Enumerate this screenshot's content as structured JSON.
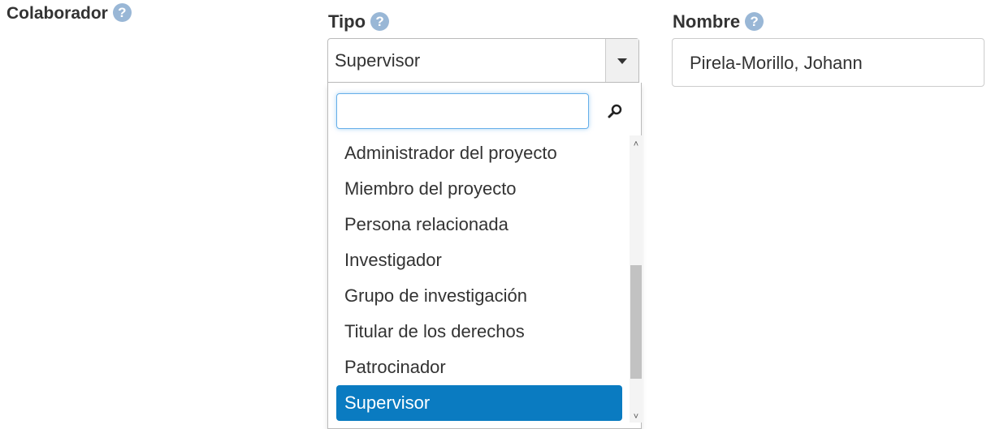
{
  "form": {
    "section_label": "Colaborador",
    "help_glyph": "?",
    "tipo": {
      "label": "Tipo",
      "selected_value": "Supervisor"
    },
    "nombre": {
      "label": "Nombre",
      "value": "Pirela-Morillo, Johann"
    }
  },
  "dropdown": {
    "search_value": "",
    "search_icon": "magnifier-icon",
    "options": [
      "Administrador del proyecto",
      "Miembro del proyecto",
      "Persona relacionada",
      "Investigador",
      "Grupo de investigación",
      "Titular de los derechos",
      "Patrocinador",
      "Supervisor"
    ],
    "selected_index": 7,
    "scrollbar": {
      "up_glyph": "˄",
      "down_glyph": "˅"
    }
  },
  "colors": {
    "text": "#333333",
    "help_icon": "#99b7d6",
    "selected_bg": "#0a7bc1",
    "focus_border": "#66afe9"
  }
}
